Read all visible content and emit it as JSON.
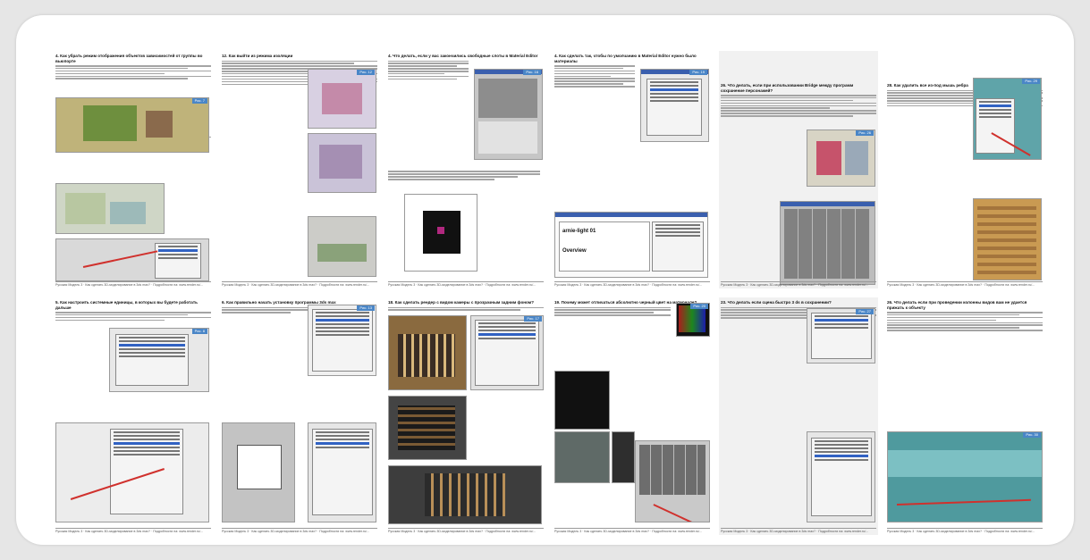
{
  "document": {
    "pages": [
      {
        "heading": "4. Как убрать режим отображения объектов зависимостей от группы во вьюпорте",
        "tag": "Рис. 7"
      },
      {
        "heading": "12. Как выйти из режима изоляции",
        "tag": "Рис. 12"
      },
      {
        "heading": "4. Что делать, если у вас закончились свободные слоты в Material Editor",
        "tag": "Рис. 16"
      },
      {
        "heading": "4. Как сделать так, чтобы по умолчанию в Material Editor нужно было материалы",
        "tag": "Рис. 19"
      },
      {
        "heading": "26. Что делать, если при использовании Bridge между программ сохранение персонажей?",
        "tag": "Рис. 26"
      },
      {
        "heading": "28. Как удалить все из-под мышь ребра",
        "tag": "Рис. 29"
      },
      {
        "heading": "5. Как настроить системные единицы, в которых вы будете работать дальше",
        "tag": "Рис. 8"
      },
      {
        "heading": "6. Как правильно начать установку программы 3ds max",
        "tag": "Рис. 13"
      },
      {
        "heading": "18. Как сделать рендер с видом камеры с прозрачным задним фоном?",
        "tag": "Рис. 17"
      },
      {
        "heading": "19. Почему может отличаться абсолютно черный цвет на материале?",
        "tag": "Рис. 20"
      },
      {
        "heading": "23. Что делать если сцена быстро 3 ds в сохранении?",
        "tag": "Рис. 27"
      },
      {
        "heading": "26. Что делать если при проведении колонны видов вам не удается прижать к объекту",
        "tag": "Рис. 30"
      }
    ],
    "footer_text": "Русская Модель 3 · Как сделать 3D-моделирование в 3ds max? · Подробности на: www.render.ru/..."
  }
}
